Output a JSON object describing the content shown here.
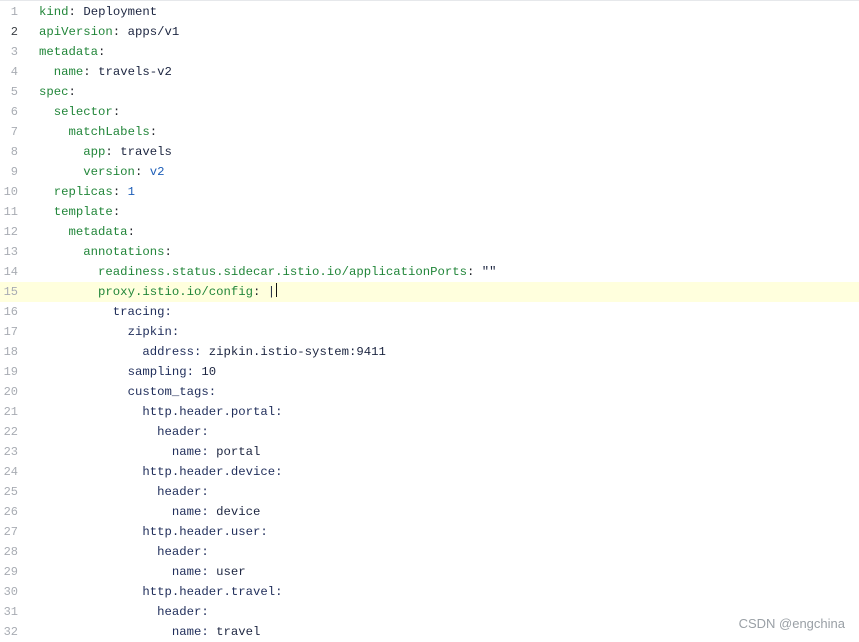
{
  "editor": {
    "lines": [
      {
        "n": "1",
        "indent": "",
        "key": "kind",
        "value": "Deployment",
        "kstyle": "green",
        "vtype": "str"
      },
      {
        "n": "2",
        "indent": "",
        "key": "apiVersion",
        "value": "apps/v1",
        "kstyle": "green",
        "vtype": "str"
      },
      {
        "n": "3",
        "indent": "",
        "key": "metadata",
        "value": "",
        "kstyle": "green",
        "vtype": "str"
      },
      {
        "n": "4",
        "indent": "  ",
        "key": "name",
        "value": "travels-v2",
        "kstyle": "green",
        "vtype": "str"
      },
      {
        "n": "5",
        "indent": "",
        "key": "spec",
        "value": "",
        "kstyle": "green",
        "vtype": "str"
      },
      {
        "n": "6",
        "indent": "  ",
        "key": "selector",
        "value": "",
        "kstyle": "green",
        "vtype": "str"
      },
      {
        "n": "7",
        "indent": "    ",
        "key": "matchLabels",
        "value": "",
        "kstyle": "green",
        "vtype": "str"
      },
      {
        "n": "8",
        "indent": "      ",
        "key": "app",
        "value": "travels",
        "kstyle": "green",
        "vtype": "str"
      },
      {
        "n": "9",
        "indent": "      ",
        "key": "version",
        "value": "v2",
        "kstyle": "green",
        "vtype": "num"
      },
      {
        "n": "10",
        "indent": "  ",
        "key": "replicas",
        "value": "1",
        "kstyle": "green",
        "vtype": "num"
      },
      {
        "n": "11",
        "indent": "  ",
        "key": "template",
        "value": "",
        "kstyle": "green",
        "vtype": "str"
      },
      {
        "n": "12",
        "indent": "    ",
        "key": "metadata",
        "value": "",
        "kstyle": "green",
        "vtype": "str"
      },
      {
        "n": "13",
        "indent": "      ",
        "key": "annotations",
        "value": "",
        "kstyle": "green",
        "vtype": "str"
      },
      {
        "n": "14",
        "indent": "        ",
        "key": "readiness.status.sidecar.istio.io/applicationPorts",
        "value": "\"\"",
        "kstyle": "green",
        "vtype": "str"
      },
      {
        "n": "15",
        "indent": "        ",
        "key": "proxy.istio.io/config",
        "value": "|",
        "kstyle": "green",
        "vtype": "str"
      },
      {
        "n": "16",
        "indent": "          ",
        "key": "tracing",
        "value": "",
        "kstyle": "navy",
        "vtype": "str"
      },
      {
        "n": "17",
        "indent": "            ",
        "key": "zipkin",
        "value": "",
        "kstyle": "navy",
        "vtype": "str"
      },
      {
        "n": "18",
        "indent": "              ",
        "key": "address",
        "value": "zipkin.istio-system:9411",
        "kstyle": "navy",
        "vtype": "str"
      },
      {
        "n": "19",
        "indent": "            ",
        "key": "sampling",
        "value": "10",
        "kstyle": "navy",
        "vtype": "str"
      },
      {
        "n": "20",
        "indent": "            ",
        "key": "custom_tags",
        "value": "",
        "kstyle": "navy",
        "vtype": "str"
      },
      {
        "n": "21",
        "indent": "              ",
        "key": "http.header.portal",
        "value": "",
        "kstyle": "navy",
        "vtype": "str"
      },
      {
        "n": "22",
        "indent": "                ",
        "key": "header",
        "value": "",
        "kstyle": "navy",
        "vtype": "str"
      },
      {
        "n": "23",
        "indent": "                  ",
        "key": "name",
        "value": "portal",
        "kstyle": "navy",
        "vtype": "str"
      },
      {
        "n": "24",
        "indent": "              ",
        "key": "http.header.device",
        "value": "",
        "kstyle": "navy",
        "vtype": "str"
      },
      {
        "n": "25",
        "indent": "                ",
        "key": "header",
        "value": "",
        "kstyle": "navy",
        "vtype": "str"
      },
      {
        "n": "26",
        "indent": "                  ",
        "key": "name",
        "value": "device",
        "kstyle": "navy",
        "vtype": "str"
      },
      {
        "n": "27",
        "indent": "              ",
        "key": "http.header.user",
        "value": "",
        "kstyle": "navy",
        "vtype": "str"
      },
      {
        "n": "28",
        "indent": "                ",
        "key": "header",
        "value": "",
        "kstyle": "navy",
        "vtype": "str"
      },
      {
        "n": "29",
        "indent": "                  ",
        "key": "name",
        "value": "user",
        "kstyle": "navy",
        "vtype": "str"
      },
      {
        "n": "30",
        "indent": "              ",
        "key": "http.header.travel",
        "value": "",
        "kstyle": "navy",
        "vtype": "str"
      },
      {
        "n": "31",
        "indent": "                ",
        "key": "header",
        "value": "",
        "kstyle": "navy",
        "vtype": "str"
      },
      {
        "n": "32",
        "indent": "                  ",
        "key": "name",
        "value": "travel",
        "kstyle": "navy",
        "vtype": "str"
      }
    ],
    "current_line": "2",
    "active_line": "15"
  },
  "colors": {
    "key_green": "#22863a",
    "key_navy": "#1f2d5a",
    "number_blue": "#1f5fb8",
    "active_line_bg": "#ffffdd"
  },
  "watermark": "CSDN @engchina"
}
